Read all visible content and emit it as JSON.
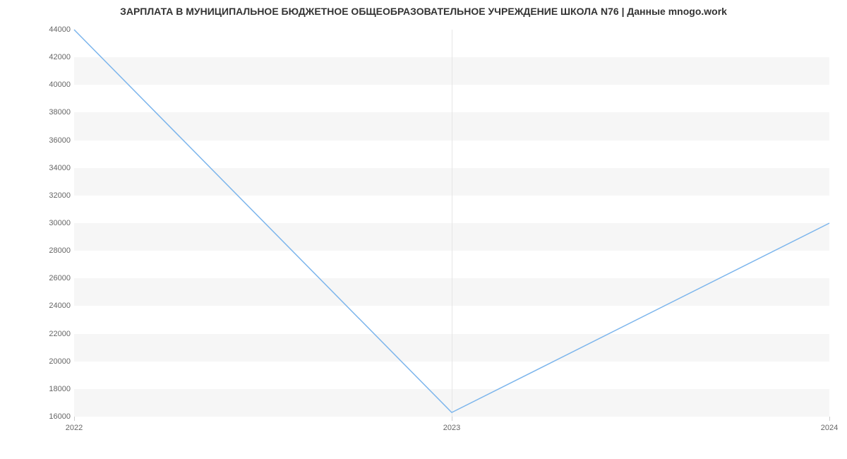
{
  "chart_data": {
    "type": "line",
    "title": "ЗАРПЛАТА В МУНИЦИПАЛЬНОЕ БЮДЖЕТНОЕ ОБЩЕОБРАЗОВАТЕЛЬНОЕ УЧРЕЖДЕНИЕ ШКОЛА N76 | Данные mnogo.work",
    "categories": [
      "2022",
      "2023",
      "2024"
    ],
    "values": [
      44000,
      16300,
      30000
    ],
    "xlabel": "",
    "ylabel": "",
    "ylim": [
      16000,
      44000
    ],
    "yticks": [
      16000,
      18000,
      20000,
      22000,
      24000,
      26000,
      28000,
      30000,
      32000,
      34000,
      36000,
      38000,
      40000,
      42000,
      44000
    ],
    "colors": {
      "line": "#7cb5ec",
      "band": "#f6f6f6",
      "bg": "#ffffff"
    },
    "grid": true
  }
}
